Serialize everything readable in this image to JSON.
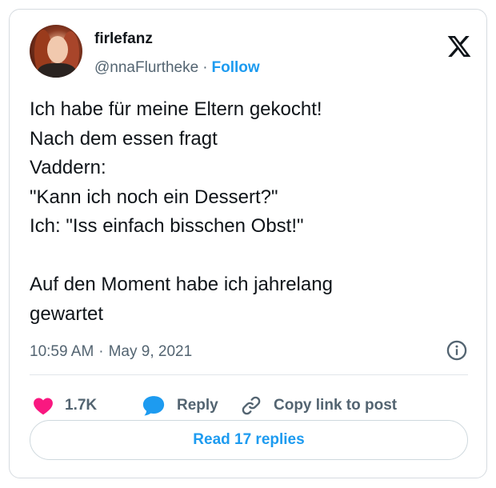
{
  "author": {
    "display_name": "firlefanz",
    "handle": "@nnaFlurtheke",
    "separator": "·",
    "follow_label": "Follow"
  },
  "tweet": {
    "text": "Ich habe für meine Eltern gekocht!\nNach dem essen fragt\nVaddern:\n\"Kann ich noch ein Dessert?\"\nIch: \"Iss einfach bisschen Obst!\"\n\nAuf den Moment habe ich jahrelang\ngewartet",
    "time": "10:59 AM",
    "separator": "·",
    "date": "May 9, 2021"
  },
  "actions": {
    "like_count": "1.7K",
    "reply_label": "Reply",
    "copy_label": "Copy link to post"
  },
  "footer": {
    "read_replies_label": "Read 17 replies"
  },
  "colors": {
    "accent": "#1d9bf0",
    "like": "#f91880",
    "text": "#0f1419",
    "muted": "#536471"
  },
  "icons": [
    "x-logo-icon",
    "info-icon",
    "heart-icon",
    "reply-bubble-icon",
    "link-icon"
  ]
}
